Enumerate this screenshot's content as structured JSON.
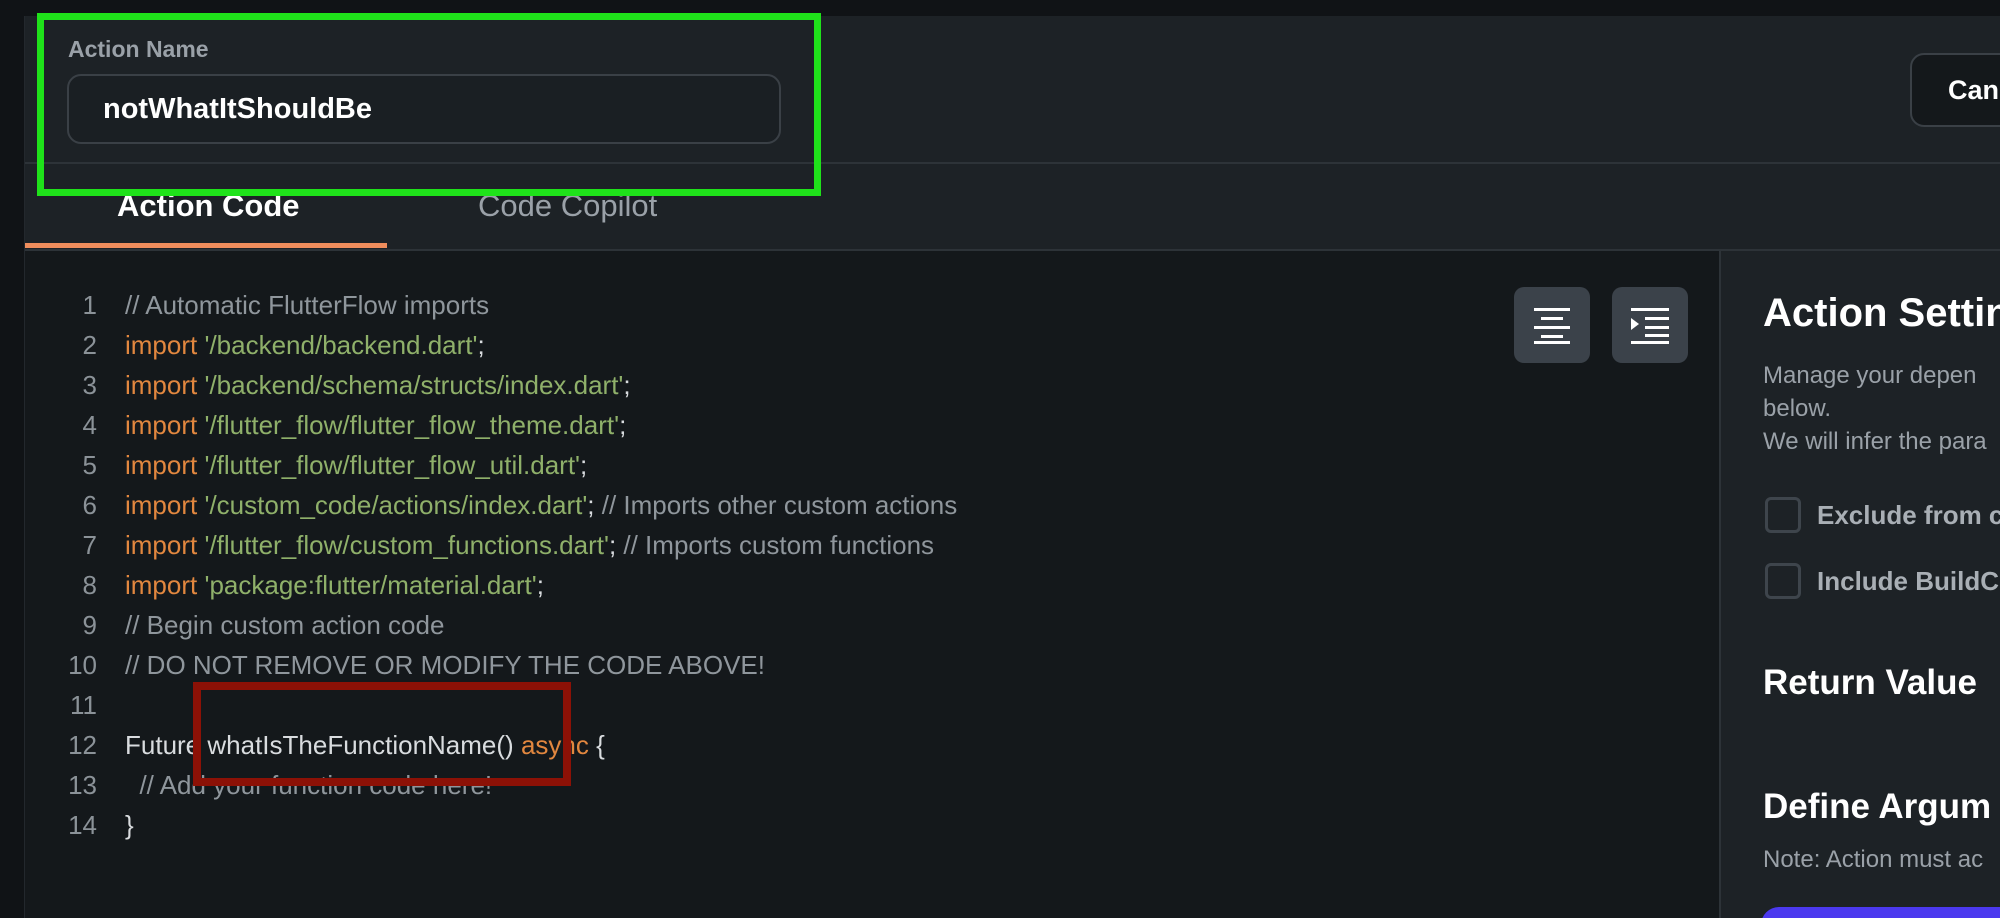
{
  "header": {
    "action_name_label": "Action Name",
    "action_name_value": "notWhatItShouldBe",
    "cancel_label": "Can"
  },
  "tabs": [
    {
      "label": "Action Code",
      "active": true
    },
    {
      "label": "Code Copilot",
      "active": false
    }
  ],
  "editor": {
    "toolbar_icons": [
      "align-center-icon",
      "indent-icon"
    ],
    "lines": [
      {
        "num": "1",
        "tokens": [
          {
            "t": "cm",
            "v": "// Automatic FlutterFlow imports"
          }
        ]
      },
      {
        "num": "2",
        "tokens": [
          {
            "t": "kw",
            "v": "import"
          },
          {
            "t": "tx",
            "v": " "
          },
          {
            "t": "st",
            "v": "'/backend/backend.dart'"
          },
          {
            "t": "tx",
            "v": ";"
          }
        ]
      },
      {
        "num": "3",
        "tokens": [
          {
            "t": "kw",
            "v": "import"
          },
          {
            "t": "tx",
            "v": " "
          },
          {
            "t": "st",
            "v": "'/backend/schema/structs/index.dart'"
          },
          {
            "t": "tx",
            "v": ";"
          }
        ]
      },
      {
        "num": "4",
        "tokens": [
          {
            "t": "kw",
            "v": "import"
          },
          {
            "t": "tx",
            "v": " "
          },
          {
            "t": "st",
            "v": "'/flutter_flow/flutter_flow_theme.dart'"
          },
          {
            "t": "tx",
            "v": ";"
          }
        ]
      },
      {
        "num": "5",
        "tokens": [
          {
            "t": "kw",
            "v": "import"
          },
          {
            "t": "tx",
            "v": " "
          },
          {
            "t": "st",
            "v": "'/flutter_flow/flutter_flow_util.dart'"
          },
          {
            "t": "tx",
            "v": ";"
          }
        ]
      },
      {
        "num": "6",
        "tokens": [
          {
            "t": "kw",
            "v": "import"
          },
          {
            "t": "tx",
            "v": " "
          },
          {
            "t": "st",
            "v": "'/custom_code/actions/index.dart'"
          },
          {
            "t": "tx",
            "v": "; "
          },
          {
            "t": "cm",
            "v": "// Imports other custom actions"
          }
        ]
      },
      {
        "num": "7",
        "tokens": [
          {
            "t": "kw",
            "v": "import"
          },
          {
            "t": "tx",
            "v": " "
          },
          {
            "t": "st",
            "v": "'/flutter_flow/custom_functions.dart'"
          },
          {
            "t": "tx",
            "v": "; "
          },
          {
            "t": "cm",
            "v": "// Imports custom functions"
          }
        ]
      },
      {
        "num": "8",
        "tokens": [
          {
            "t": "kw",
            "v": "import"
          },
          {
            "t": "tx",
            "v": " "
          },
          {
            "t": "st",
            "v": "'package:flutter/material.dart'"
          },
          {
            "t": "tx",
            "v": ";"
          }
        ]
      },
      {
        "num": "9",
        "tokens": [
          {
            "t": "cm",
            "v": "// Begin custom action code"
          }
        ]
      },
      {
        "num": "10",
        "tokens": [
          {
            "t": "cm",
            "v": "// DO NOT REMOVE OR MODIFY THE CODE ABOVE!"
          }
        ]
      },
      {
        "num": "11",
        "tokens": []
      },
      {
        "num": "12",
        "tokens": [
          {
            "t": "tx",
            "v": "Future whatIsTheFunctionName() "
          },
          {
            "t": "kw",
            "v": "async"
          },
          {
            "t": "tx",
            "v": " {"
          }
        ]
      },
      {
        "num": "13",
        "tokens": [
          {
            "t": "cm",
            "v": "  // Add your function code here!"
          }
        ]
      },
      {
        "num": "14",
        "tokens": [
          {
            "t": "tx",
            "v": "}"
          }
        ]
      }
    ]
  },
  "settings": {
    "title": "Action Settin",
    "desc_line1": "Manage your depen",
    "desc_line2": "below.",
    "desc_line3": "We will infer the para",
    "checkbox1_label": "Exclude from c",
    "checkbox2_label": "Include BuildCo",
    "return_value_heading": "Return Value",
    "define_args_heading": "Define Argum",
    "note": "Note: Action must ac"
  },
  "colors": {
    "background": "#14181b",
    "panel": "#1d2226",
    "accent_tab": "#ef8d5c",
    "keyword": "#e2873f",
    "string": "#8fb06a",
    "comment": "#8f969c",
    "annotation_green": "#1fe21a",
    "annotation_red": "#8c1106",
    "primary_button": "#4b39ef"
  }
}
